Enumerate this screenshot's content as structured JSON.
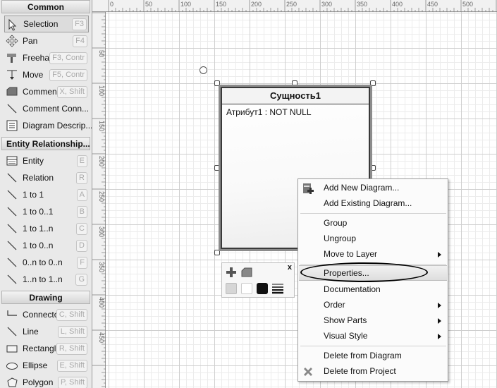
{
  "toolbox": {
    "sections": {
      "common": "Common",
      "entity_relationship": "Entity Relationship...",
      "drawing": "Drawing"
    },
    "common_items": [
      {
        "label": "Selection",
        "key": "F3",
        "icon": "arrow-pointer-icon"
      },
      {
        "label": "Pan",
        "key": "F4",
        "icon": "pan-icon"
      },
      {
        "label": "Freehar",
        "key": "F3, Contr",
        "icon": "freehand-icon"
      },
      {
        "label": "Move",
        "key": "F5, Contr",
        "icon": "move-icon"
      },
      {
        "label": "Commen",
        "key": "X, Shift",
        "icon": "comment-icon"
      },
      {
        "label": "Comment  Conn...",
        "key": "",
        "icon": "comment-connector-icon"
      },
      {
        "label": "Diagram Descrip...",
        "key": "",
        "icon": "diagram-description-icon"
      }
    ],
    "er_items": [
      {
        "label": "Entity",
        "key": "E",
        "icon": "entity-icon"
      },
      {
        "label": "Relation",
        "key": "R",
        "icon": "line-icon"
      },
      {
        "label": "1 to 1",
        "key": "A",
        "icon": "line-icon"
      },
      {
        "label": "1 to 0..1",
        "key": "B",
        "icon": "line-icon"
      },
      {
        "label": "1 to 1..n",
        "key": "C",
        "icon": "line-icon"
      },
      {
        "label": "1 to 0..n",
        "key": "D",
        "icon": "line-icon"
      },
      {
        "label": "0..n to 0..n",
        "key": "F",
        "icon": "line-icon"
      },
      {
        "label": "1..n to 1..n",
        "key": "G",
        "icon": "line-icon"
      }
    ],
    "drawing_items": [
      {
        "label": "Connecto",
        "key": "C, Shift",
        "icon": "connector-icon"
      },
      {
        "label": "Line",
        "key": "L, Shift",
        "icon": "line-icon"
      },
      {
        "label": "Rectangl",
        "key": "R, Shift",
        "icon": "rectangle-icon"
      },
      {
        "label": "Ellipse",
        "key": "E, Shift",
        "icon": "ellipse-icon"
      },
      {
        "label": "Polygon",
        "key": "P, Shift",
        "icon": "polygon-icon"
      }
    ]
  },
  "ruler": {
    "top_labels": [
      "0",
      "50",
      "100",
      "150",
      "200",
      "250",
      "300",
      "350",
      "400",
      "450",
      "500"
    ],
    "left_labels": [
      "50",
      "100",
      "150",
      "200",
      "250",
      "300",
      "350",
      "400",
      "450"
    ]
  },
  "entity": {
    "title": "Сущность1",
    "attribute": "Атрибут1 :  NOT NULL"
  },
  "mini_toolbar": {
    "close": "x",
    "colors": [
      "#d6d6d6",
      "#ffffff",
      "#111111"
    ]
  },
  "context_menu": {
    "items": [
      {
        "label": "Add New Diagram...",
        "icon": "add-diagram-icon"
      },
      {
        "label": "Add Existing Diagram..."
      },
      {
        "label": "Group"
      },
      {
        "label": "Ungroup"
      },
      {
        "label": "Move to Layer",
        "submenu": true
      },
      {
        "label": "Properties...",
        "highlighted": true
      },
      {
        "label": "Documentation"
      },
      {
        "label": "Order",
        "submenu": true
      },
      {
        "label": "Show Parts",
        "submenu": true
      },
      {
        "label": "Visual Style",
        "submenu": true
      },
      {
        "label": "Delete from Diagram"
      },
      {
        "label": "Delete from Project",
        "icon": "delete-x-icon"
      }
    ]
  }
}
